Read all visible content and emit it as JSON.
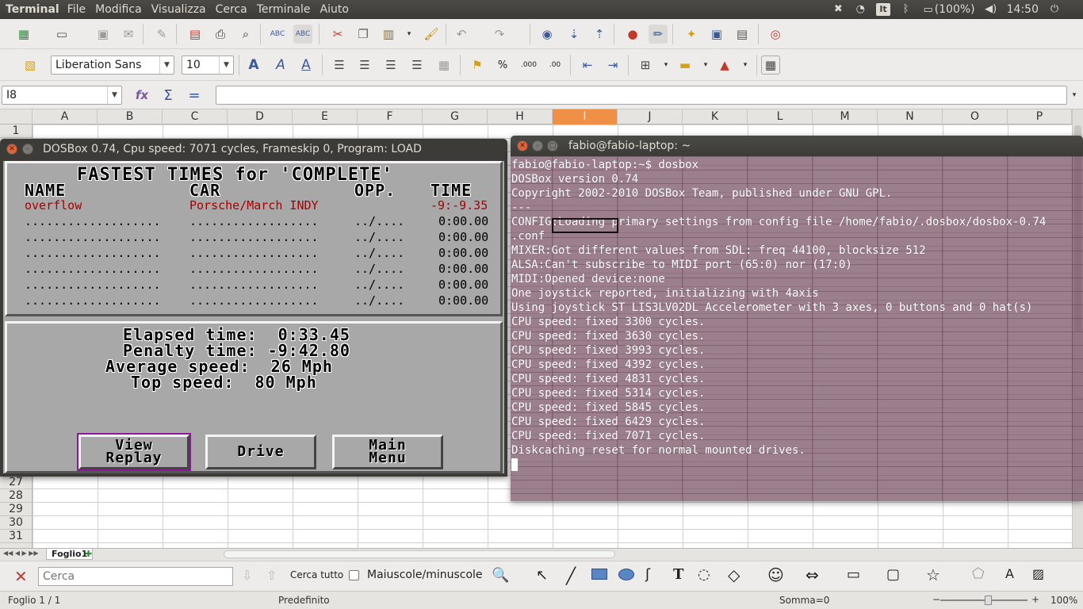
{
  "top_panel": {
    "app_title": "Terminal",
    "menus": [
      "File",
      "Modifica",
      "Visualizza",
      "Cerca",
      "Terminale",
      "Aiuto"
    ],
    "keyboard_layout": "It",
    "battery": "(100%)",
    "clock": "14:50"
  },
  "toolbar2": {
    "font_name": "Liberation Sans",
    "font_size": "10"
  },
  "formula_bar": {
    "cell_ref": "I8",
    "formula": ""
  },
  "sheet": {
    "columns": [
      "A",
      "B",
      "C",
      "D",
      "E",
      "F",
      "G",
      "H",
      "I",
      "J",
      "K",
      "L",
      "M",
      "N",
      "O",
      "P"
    ],
    "selected_column": "I",
    "rows_top": [
      "1"
    ],
    "rows_bottom": [
      "27",
      "28",
      "29",
      "30",
      "31"
    ],
    "tab_name": "Foglio1"
  },
  "findbar": {
    "search_placeholder": "Cerca",
    "find_all": "Cerca tutto",
    "match_case": "Maiuscole/minuscole"
  },
  "statusbar": {
    "sheet": "Foglio 1 / 1",
    "style": "Predefinito",
    "sum": "Somma=0",
    "zoom": "100%"
  },
  "dosbox": {
    "title": "DOSBox 0.74, Cpu speed:     7071 cycles, Frameskip  0, Program:    LOAD",
    "heading": "FASTEST TIMES for 'COMPLETE'",
    "col_name": "NAME",
    "col_car": "CAR",
    "col_opp": "OPP.",
    "col_time": "TIME",
    "records": [
      {
        "name": "overflow",
        "car": "Porsche/March INDY",
        "opp": "",
        "time": "-9:-9.35"
      },
      {
        "name": "...................",
        "car": "..................",
        "opp": "../....",
        "time": "0:00.00"
      },
      {
        "name": "...................",
        "car": "..................",
        "opp": "../....",
        "time": "0:00.00"
      },
      {
        "name": "...................",
        "car": "..................",
        "opp": "../....",
        "time": "0:00.00"
      },
      {
        "name": "...................",
        "car": "..................",
        "opp": "../....",
        "time": "0:00.00"
      },
      {
        "name": "...................",
        "car": "..................",
        "opp": "../....",
        "time": "0:00.00"
      },
      {
        "name": "...................",
        "car": "..................",
        "opp": "../....",
        "time": "0:00.00"
      }
    ],
    "stats": [
      "Elapsed time:  0:33.45",
      "Penalty time: -9:42.80",
      "Average speed:  26 Mph",
      "Top speed:  80 Mph"
    ],
    "buttons": {
      "view_replay": "View\nReplay",
      "drive": "Drive",
      "main_menu": "Main\nMenu"
    }
  },
  "terminal": {
    "title": "fabio@fabio-laptop: ~",
    "lines": [
      "fabio@fabio-laptop:~$ dosbox",
      "DOSBox version 0.74",
      "Copyright 2002-2010 DOSBox Team, published under GNU GPL.",
      "---",
      "CONFIG:Loading primary settings from config file /home/fabio/.dosbox/dosbox-0.74",
      ".conf",
      "MIXER:Got different values from SDL: freq 44100, blocksize 512",
      "ALSA:Can't subscribe to MIDI port (65:0) nor (17:0)",
      "MIDI:Opened device:none",
      "One joystick reported, initializing with 4axis",
      "Using joystick ST LIS3LV02DL Accelerometer with 3 axes, 0 buttons and 0 hat(s)",
      "CPU speed: fixed 3300 cycles.",
      "CPU speed: fixed 3630 cycles.",
      "CPU speed: fixed 3993 cycles.",
      "CPU speed: fixed 4392 cycles.",
      "CPU speed: fixed 4831 cycles.",
      "CPU speed: fixed 5314 cycles.",
      "CPU speed: fixed 5845 cycles.",
      "CPU speed: fixed 6429 cycles.",
      "CPU speed: fixed 7071 cycles.",
      "Diskcaching reset for normal mounted drives."
    ]
  }
}
